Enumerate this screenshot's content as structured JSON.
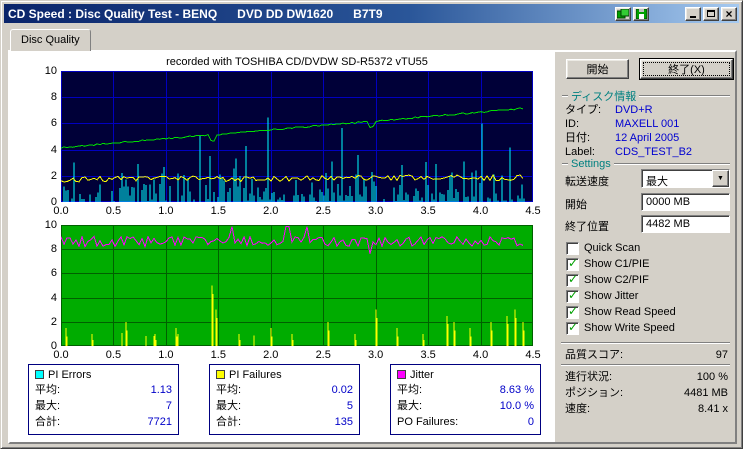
{
  "window": {
    "title": "CD Speed : Disc Quality Test - BENQ      DVD DD DW1620      B7T9",
    "close_glyph": "×"
  },
  "tab": {
    "label": "Disc Quality"
  },
  "chart_header": "recorded with TOSHIBA CD/DVDW SD-R5372 vTU55",
  "chart_data": [
    {
      "type": "bar",
      "title": "PI Errors scan (recorded with TOSHIBA CD/DVDW SD-R5372 vTU55)",
      "x_ticks": [
        "0.0",
        "0.5",
        "1.0",
        "1.5",
        "2.0",
        "2.5",
        "3.0",
        "3.5",
        "4.0",
        "4.5"
      ],
      "y_ticks": [
        "10",
        "8",
        "6",
        "4",
        "2",
        "0"
      ],
      "x_range": [
        0,
        4.5
      ],
      "y_range": [
        0,
        10
      ],
      "data_end": 4.42,
      "bg": "#000038",
      "grid": "#0000C0",
      "series": [
        {
          "name": "pi-errors",
          "type": "bars",
          "color": "#00FFFF",
          "avg": 1.13,
          "max": 7
        },
        {
          "name": "read-speed",
          "type": "line",
          "color": "#FFFF00",
          "start": 1.75,
          "end": 1.85,
          "noise": 0.22
        },
        {
          "name": "write-speed",
          "type": "line",
          "color": "#00E000",
          "start": 4.15,
          "end": 7.15,
          "noise": 0.06
        }
      ]
    },
    {
      "type": "line",
      "title": "Jitter / PI Failures scan",
      "x_ticks": [
        "0.0",
        "0.5",
        "1.0",
        "1.5",
        "2.0",
        "2.5",
        "3.0",
        "3.5",
        "4.0",
        "4.5"
      ],
      "y_ticks": [
        "10",
        "8",
        "6",
        "4",
        "2",
        "0"
      ],
      "x_range": [
        0,
        4.5
      ],
      "y_range": [
        0,
        10
      ],
      "data_end": 4.42,
      "bg": "#00AC00",
      "grid": "#006000",
      "series": [
        {
          "name": "jitter",
          "type": "line",
          "color": "#FF00FF",
          "avg": 8.63,
          "max": 10.0,
          "noise": 0.42
        },
        {
          "name": "pi-failures",
          "type": "bars",
          "color": "#FFFF00",
          "avg": 0.02,
          "max": 5,
          "spikes": [
            [
              0.05,
              1.5
            ],
            [
              0.3,
              1
            ],
            [
              0.62,
              2
            ],
            [
              0.9,
              1
            ],
            [
              1.1,
              1.5
            ],
            [
              1.44,
              5
            ],
            [
              1.48,
              3
            ],
            [
              1.7,
              1
            ],
            [
              2.0,
              1.5
            ],
            [
              2.2,
              1
            ],
            [
              2.55,
              2
            ],
            [
              2.8,
              1
            ],
            [
              3.0,
              3
            ],
            [
              3.2,
              1.5
            ],
            [
              3.45,
              1
            ],
            [
              3.68,
              2.5
            ],
            [
              3.75,
              2
            ],
            [
              3.9,
              1.5
            ],
            [
              4.1,
              2
            ],
            [
              4.25,
              2.5
            ],
            [
              4.33,
              3
            ],
            [
              4.4,
              2
            ]
          ]
        }
      ]
    }
  ],
  "stats": {
    "boxes": [
      {
        "title": "PI Errors",
        "color": "#00FFFF",
        "rows": [
          {
            "label": "平均:",
            "value": "1.13"
          },
          {
            "label": "最大:",
            "value": "7"
          },
          {
            "label": "合計:",
            "value": "7721"
          }
        ]
      },
      {
        "title": "PI Failures",
        "color": "#FFFF00",
        "rows": [
          {
            "label": "平均:",
            "value": "0.02"
          },
          {
            "label": "最大:",
            "value": "5"
          },
          {
            "label": "合計:",
            "value": "135"
          }
        ]
      },
      {
        "title": "Jitter",
        "color": "#FF00FF",
        "rows": [
          {
            "label": "平均:",
            "value": "8.63 %"
          },
          {
            "label": "最大:",
            "value": "10.0 %"
          },
          {
            "label": "PO Failures:",
            "value": "0"
          }
        ]
      }
    ]
  },
  "sidebar": {
    "start_button": "開始",
    "exit_button": "終了(X)",
    "disc_info": {
      "header": "ディスク情報",
      "rows": [
        {
          "label": "タイプ:",
          "value": "DVD+R"
        },
        {
          "label": "ID:",
          "value": "MAXELL 001"
        },
        {
          "label": "日付:",
          "value": "12 April 2005"
        },
        {
          "label": "Label:",
          "value": "CDS_TEST_B2"
        }
      ]
    },
    "settings": {
      "header": "Settings",
      "speed_label": "転送速度",
      "speed_value": "最大",
      "start_label": "開始",
      "start_value": "0000 MB",
      "end_label": "終了位置",
      "end_value": "4482 MB",
      "checkboxes": [
        {
          "label": "Quick Scan",
          "checked": false
        },
        {
          "label": "Show C1/PIE",
          "checked": true
        },
        {
          "label": "Show C2/PIF",
          "checked": true
        },
        {
          "label": "Show Jitter",
          "checked": true
        },
        {
          "label": "Show Read Speed",
          "checked": true
        },
        {
          "label": "Show Write Speed",
          "checked": true
        }
      ]
    },
    "quality": {
      "label": "品質スコア:",
      "value": "97"
    },
    "status": [
      {
        "label": "進行状況:",
        "value": "100 %"
      },
      {
        "label": "ポジション:",
        "value": "4481 MB"
      },
      {
        "label": "速度:",
        "value": "8.41 x"
      }
    ]
  },
  "colors": {
    "titlebar_start": "#0A246A",
    "titlebar_end": "#A6CAF0",
    "chrome": "#D4D0C8",
    "section_header": "#008080",
    "value_blue": "#0000C8",
    "pie_cyan": "#00FFFF",
    "pif_yellow": "#FFFF00",
    "jitter_magenta": "#FF00FF",
    "write_green": "#00E000"
  }
}
